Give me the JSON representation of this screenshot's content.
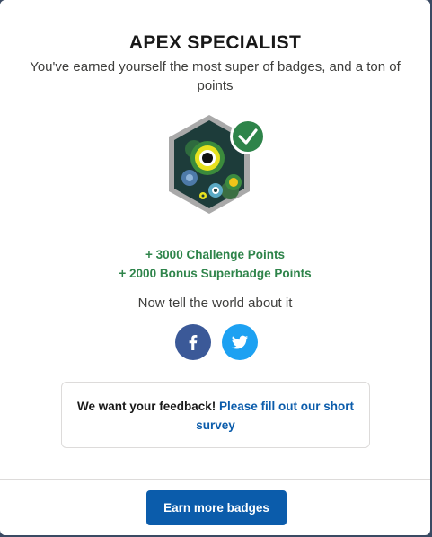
{
  "modal": {
    "title": "APEX SPECIALIST",
    "subtitle": "You've earned yourself the most super of badges, and a ton of points"
  },
  "badge": {
    "icon": "gears-badge-icon",
    "earned": true,
    "check_icon": "checkmark-icon"
  },
  "points": {
    "challenge": "+ 3000 Challenge Points",
    "bonus": "+ 2000 Bonus Superbadge Points"
  },
  "share": {
    "prompt": "Now tell the world about it",
    "facebook_icon": "facebook-icon",
    "twitter_icon": "twitter-icon"
  },
  "feedback": {
    "text": "We want your feedback! ",
    "link": "Please fill out our short survey"
  },
  "footer": {
    "button_label": "Earn more badges"
  },
  "colors": {
    "accent": "#0b5cab",
    "points": "#2e844a",
    "facebook": "#3b5998",
    "twitter": "#1da1f2",
    "check": "#2e844a"
  }
}
